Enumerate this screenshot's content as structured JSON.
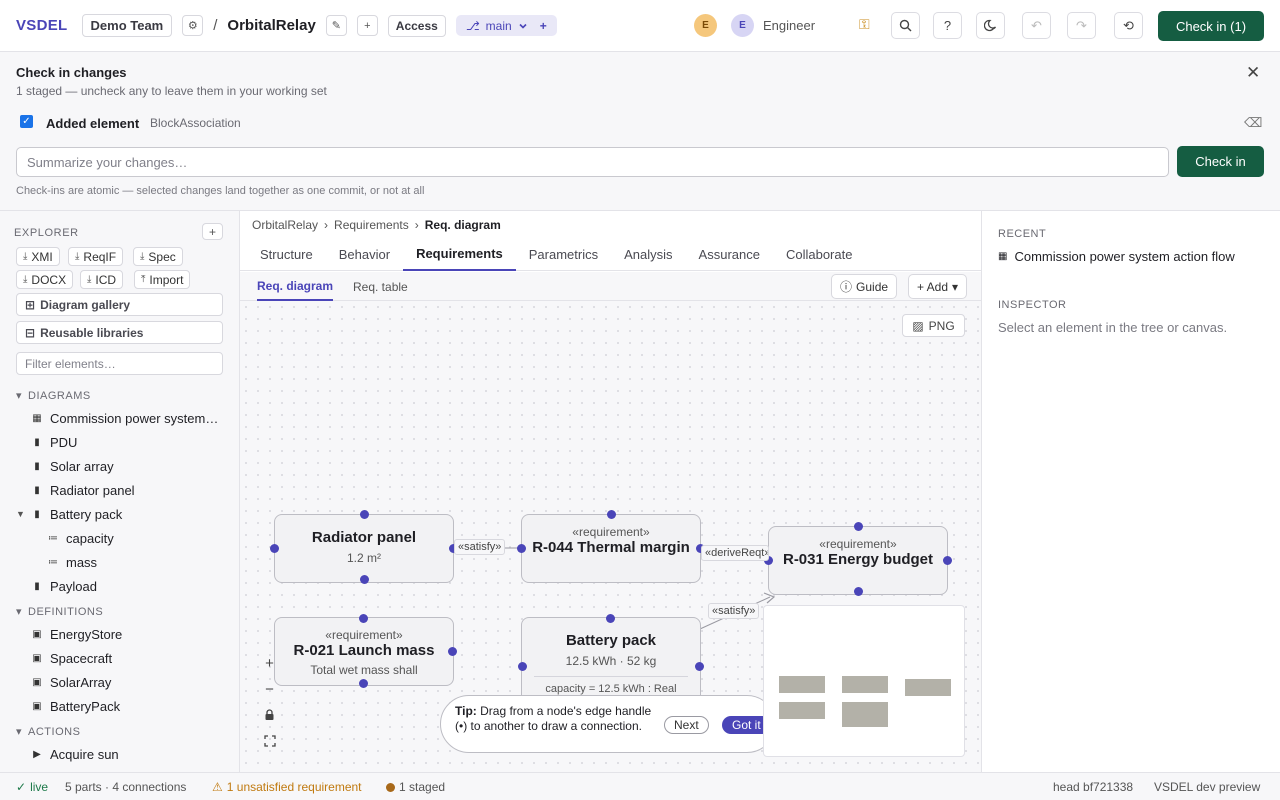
{
  "header": {
    "brand": "VSDEL",
    "team": "Demo Team",
    "project": "OrbitalRelay",
    "access": "Access",
    "branch": "main",
    "avatars": [
      "E",
      "E"
    ],
    "role": "Engineer",
    "checkin_button": "Check in (1)"
  },
  "checkin": {
    "title": "Check in changes",
    "subtitle": "1 staged — uncheck any to leave them in your working set",
    "change_kind": "Added element",
    "change_type": "BlockAssociation",
    "input_placeholder": "Summarize your changes…",
    "submit": "Check in",
    "note": "Check-ins are atomic — selected changes land together as one commit, or not at all"
  },
  "explorer": {
    "title": "EXPLORER",
    "chips": [
      "XMI",
      "ReqIF",
      "Spec",
      "DOCX",
      "ICD",
      "Import"
    ],
    "gallery": "Diagram gallery",
    "libraries": "Reusable libraries",
    "filter_placeholder": "Filter elements…",
    "sections": {
      "diagrams": "DIAGRAMS",
      "definitions": "DEFINITIONS",
      "actions": "ACTIONS"
    },
    "diagrams": [
      "Commission power system…",
      "PDU",
      "Solar array",
      "Radiator panel",
      "Battery pack",
      "capacity",
      "mass",
      "Payload"
    ],
    "definitions": [
      "EnergyStore",
      "Spacecraft",
      "SolarArray",
      "BatteryPack"
    ],
    "actions": [
      "Acquire sun"
    ]
  },
  "main": {
    "breadcrumb": [
      "OrbitalRelay",
      "Requirements",
      "Req. diagram"
    ],
    "tabs": [
      "Structure",
      "Behavior",
      "Requirements",
      "Parametrics",
      "Analysis",
      "Assurance",
      "Collaborate"
    ],
    "subtabs": [
      "Req. diagram",
      "Req. table"
    ],
    "guide": "Guide",
    "add": "+ Add",
    "png": "PNG"
  },
  "diagram": {
    "nodes": {
      "radiator": {
        "title": "Radiator panel",
        "sub": "1.2 m²"
      },
      "r044": {
        "stereo": "«requirement»",
        "title": "R-044 Thermal margin"
      },
      "r031": {
        "stereo": "«requirement»",
        "title": "R-031 Energy budget"
      },
      "r021": {
        "stereo": "«requirement»",
        "title": "R-021 Launch mass",
        "sub": "Total wet mass shall"
      },
      "battery": {
        "title": "Battery pack",
        "sub": "12.5 kWh · 52 kg",
        "attr": "capacity = 12.5 kWh : Real"
      }
    },
    "edges": {
      "satisfy1": "«satisfy»",
      "derive": "«deriveReqt»",
      "satisfy2": "«satisfy»"
    }
  },
  "tip": {
    "label": "Tip:",
    "text": "Drag from a node's edge handle (•) to another to draw a connection.",
    "next": "Next",
    "got_it": "Got it"
  },
  "right": {
    "recent_title": "RECENT",
    "recent_item": "Commission power system action flow",
    "inspector_title": "INSPECTOR",
    "inspector_empty": "Select an element in the tree or canvas."
  },
  "status": {
    "live": "live",
    "summary": "5 parts · 4 connections",
    "warning": "1 unsatisfied requirement",
    "staged": "1 staged",
    "head": "head bf721338",
    "env": "VSDEL dev preview"
  },
  "colors": {
    "accent": "#4a45b8",
    "primary": "#155d42",
    "warning": "#c07a10"
  }
}
